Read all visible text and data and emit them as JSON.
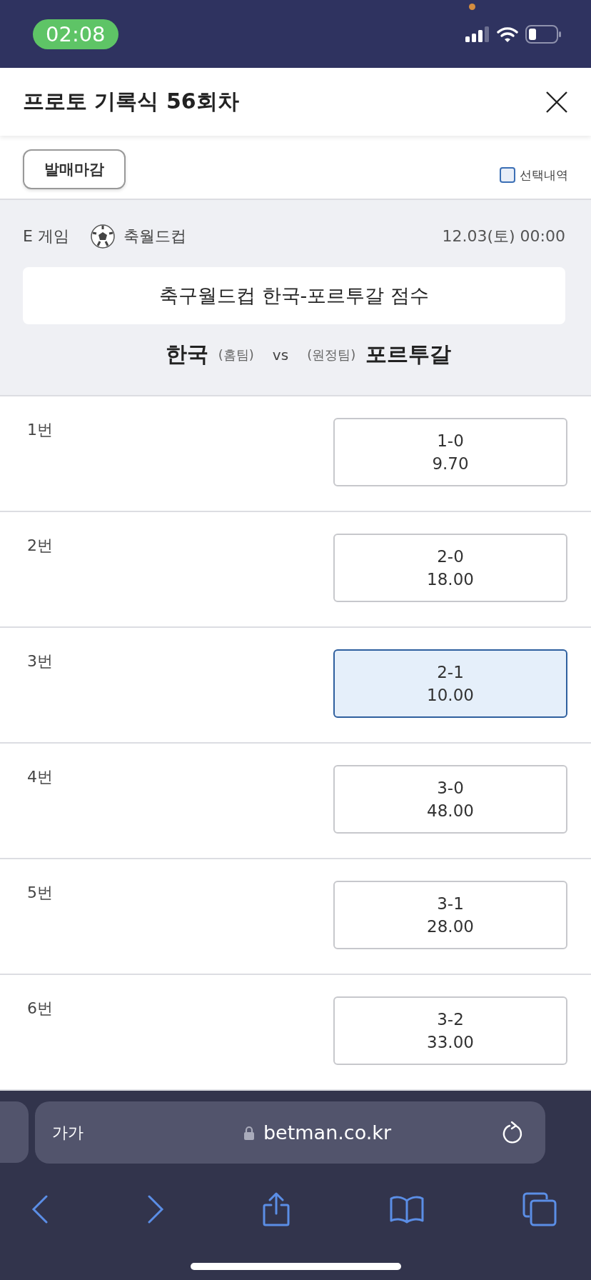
{
  "status_bar": {
    "time": "02:08"
  },
  "header": {
    "title": "프로토 기록식 56회차"
  },
  "toolbar": {
    "status_button": "발매마감",
    "selection_filter": {
      "label": "선택내역",
      "checked": false
    }
  },
  "game": {
    "game_label": "E 게임",
    "sport": "축월드컵",
    "datetime": "12.03(토) 00:00",
    "question": "축구월드컵 한국-포르투갈 점수",
    "home_team": "한국",
    "home_tag": "(홈팀)",
    "vs": "vs",
    "away_tag": "(원정팀)",
    "away_team": "포르투갈"
  },
  "options": [
    {
      "number": "1번",
      "score": "1-0",
      "odds": "9.70",
      "selected": false
    },
    {
      "number": "2번",
      "score": "2-0",
      "odds": "18.00",
      "selected": false
    },
    {
      "number": "3번",
      "score": "2-1",
      "odds": "10.00",
      "selected": true
    },
    {
      "number": "4번",
      "score": "3-0",
      "odds": "48.00",
      "selected": false
    },
    {
      "number": "5번",
      "score": "3-1",
      "odds": "28.00",
      "selected": false
    },
    {
      "number": "6번",
      "score": "3-2",
      "odds": "33.00",
      "selected": false
    }
  ],
  "browser": {
    "text_size": "가가",
    "url": "betman.co.kr"
  }
}
